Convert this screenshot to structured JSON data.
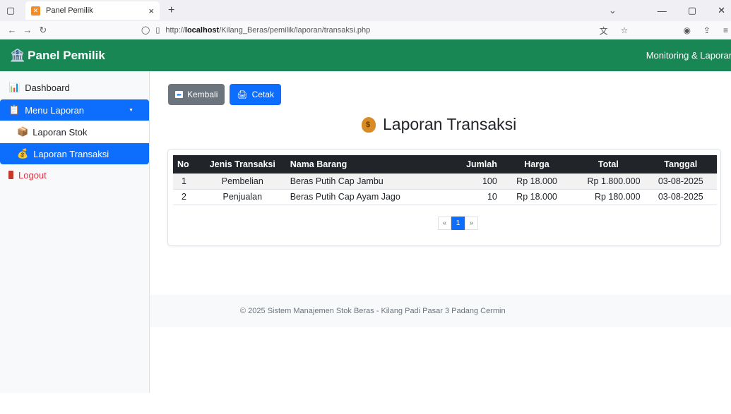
{
  "browser": {
    "tab_title": "Panel Pemilik",
    "url_prefix": "http://",
    "url_host": "localhost",
    "url_path": "/Kilang_Beras/pemilik/laporan/transaksi.php"
  },
  "header": {
    "brand": "Panel Pemilik",
    "right_text": "Monitoring & Laporan"
  },
  "sidebar": {
    "items": [
      {
        "label": "Dashboard"
      },
      {
        "label": "Menu Laporan"
      },
      {
        "label": "Laporan Stok"
      },
      {
        "label": "Laporan Transaksi"
      },
      {
        "label": "Logout"
      }
    ]
  },
  "toolbar": {
    "back_label": "Kembali",
    "print_label": "Cetak"
  },
  "page": {
    "title": "Laporan Transaksi"
  },
  "table": {
    "headers": [
      "No",
      "Jenis Transaksi",
      "Nama Barang",
      "Jumlah",
      "Harga",
      "Total",
      "Tanggal"
    ],
    "rows": [
      [
        "1",
        "Pembelian",
        "Beras Putih Cap Jambu",
        "100",
        "Rp 18.000",
        "Rp 1.800.000",
        "03-08-2025"
      ],
      [
        "2",
        "Penjualan",
        "Beras Putih Cap Ayam Jago",
        "10",
        "Rp 18.000",
        "Rp 180.000",
        "03-08-2025"
      ]
    ]
  },
  "pagination": {
    "prev": "«",
    "current": "1",
    "next": "»"
  },
  "footer": {
    "text": "© 2025 Sistem Manajemen Stok Beras - Kilang Padi Pasar 3 Padang Cermin"
  }
}
